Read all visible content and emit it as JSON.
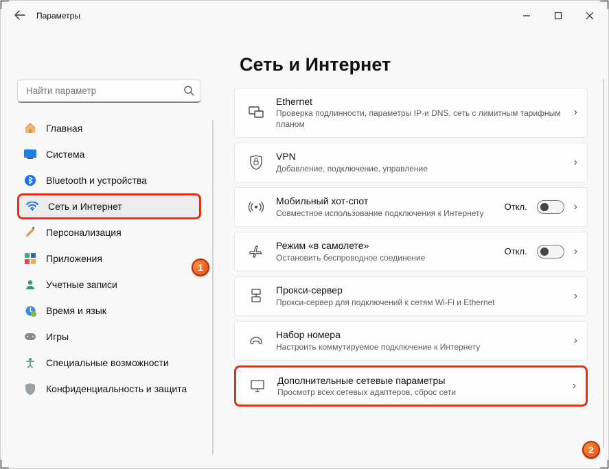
{
  "window": {
    "title": "Параметры"
  },
  "search": {
    "placeholder": "Найти параметр"
  },
  "sidebar": {
    "items": [
      {
        "label": "Главная"
      },
      {
        "label": "Система"
      },
      {
        "label": "Bluetooth и устройства"
      },
      {
        "label": "Сеть и Интернет"
      },
      {
        "label": "Персонализация"
      },
      {
        "label": "Приложения"
      },
      {
        "label": "Учетные записи"
      },
      {
        "label": "Время и язык"
      },
      {
        "label": "Игры"
      },
      {
        "label": "Специальные возможности"
      },
      {
        "label": "Конфиденциальность и защита"
      }
    ]
  },
  "page": {
    "title": "Сеть и Интернет"
  },
  "cards": [
    {
      "title": "Ethernet",
      "sub": "Проверка подлинности, параметры IP-и DNS, сеть с лимитным тарифным планом"
    },
    {
      "title": "VPN",
      "sub": "Добавление, подключение, управление"
    },
    {
      "title": "Мобильный хот-спот",
      "sub": "Совместное использование подключения к Интернету",
      "status": "Откл."
    },
    {
      "title": "Режим «в самолете»",
      "sub": "Остановить беспроводное соединение",
      "status": "Откл."
    },
    {
      "title": "Прокси-сервер",
      "sub": "Прокси-сервер для подключений к сетям Wi-Fi и Ethernet"
    },
    {
      "title": "Набор номера",
      "sub": "Настроить коммутируемое подключение к Интернету"
    },
    {
      "title": "Дополнительные сетевые параметры",
      "sub": "Просмотр всех сетевых адаптеров, сброс сети"
    }
  ],
  "badges": {
    "one": "1",
    "two": "2"
  }
}
